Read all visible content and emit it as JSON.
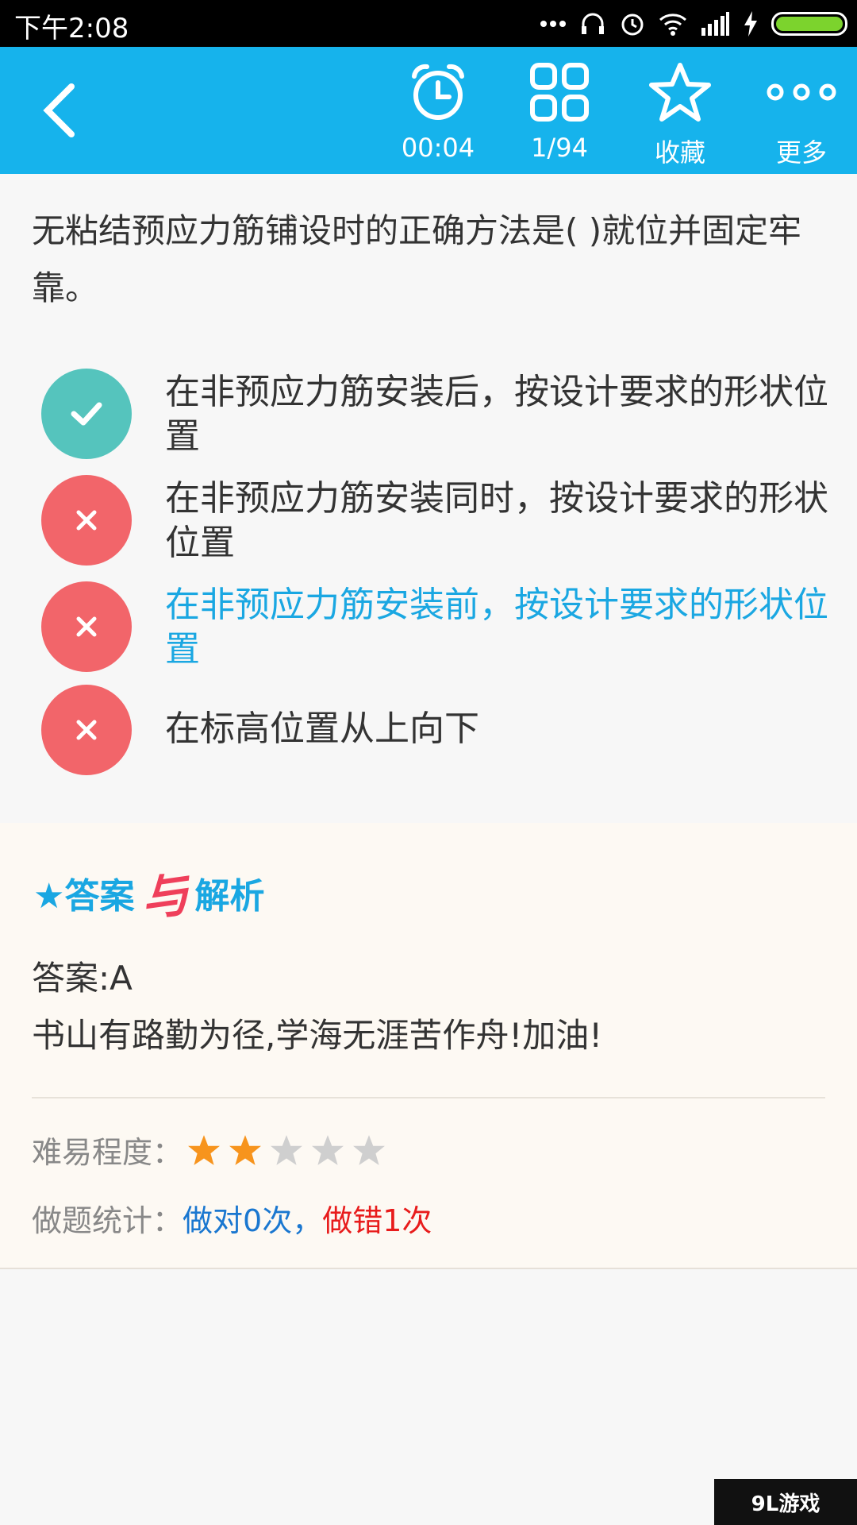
{
  "status_bar": {
    "time": "下午2:08",
    "icons": [
      "dots-icon",
      "headphones-icon",
      "alarm-icon",
      "wifi-icon",
      "signal-icon",
      "charging-icon",
      "battery-icon"
    ]
  },
  "toolbar": {
    "back_icon": "back-arrow-icon",
    "timer_label": "00:04",
    "progress_label": "1/94",
    "favorite_label": "收藏",
    "more_label": "更多",
    "background": "#16b3ec"
  },
  "question": {
    "text": "无粘结预应力筋铺设时的正确方法是(   )就位并固定牢靠。"
  },
  "options": [
    {
      "status": "correct",
      "text": "在非预应力筋安装后，按设计要求的形状位置"
    },
    {
      "status": "wrong",
      "text": "在非预应力筋安装同时，按设计要求的形状位置"
    },
    {
      "status": "wrong",
      "text": "在非预应力筋安装前，按设计要求的形状位置",
      "selected": true
    },
    {
      "status": "wrong",
      "text": "在标高位置从上向下"
    }
  ],
  "analysis": {
    "title_part1": "★答案",
    "title_part2": "与",
    "title_part3": "解析",
    "answer": "答案:A",
    "note": "书山有路勤为径,学海无涯苦作舟!加油!",
    "difficulty_label": "难易程度：",
    "difficulty_rating": 2,
    "difficulty_max": 5,
    "stats_label": "做题统计：",
    "stats_correct": "做对0次",
    "stats_sep": "，",
    "stats_wrong": "做错1次"
  },
  "watermark": "9L游戏"
}
